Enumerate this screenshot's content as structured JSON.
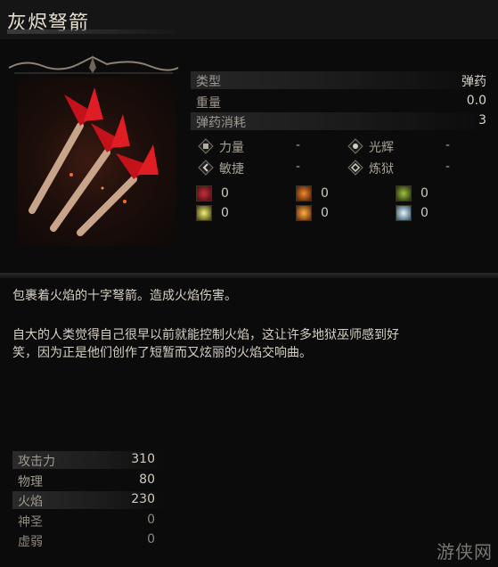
{
  "item": {
    "name": "灰烬弩箭"
  },
  "stats": [
    {
      "label": "类型",
      "value": "弹药"
    },
    {
      "label": "重量",
      "value": "0.0"
    },
    {
      "label": "弹药消耗",
      "value": "3"
    }
  ],
  "requirements": [
    {
      "label": "力量",
      "value": "-",
      "icon": "strength-icon"
    },
    {
      "label": "光辉",
      "value": "-",
      "icon": "radiance-icon"
    },
    {
      "label": "敏捷",
      "value": "-",
      "icon": "dexterity-icon"
    },
    {
      "label": "炼狱",
      "value": "-",
      "icon": "inferno-icon"
    }
  ],
  "elements": [
    {
      "value": "0",
      "icon": "bleed-icon",
      "color": "#7a1a1a"
    },
    {
      "value": "0",
      "icon": "fire-icon",
      "color": "#b44a12"
    },
    {
      "value": "0",
      "icon": "poison-icon",
      "color": "#4f6a1c"
    },
    {
      "value": "0",
      "icon": "lightning-icon",
      "color": "#c9c23a"
    },
    {
      "value": "0",
      "icon": "burn-icon",
      "color": "#d0631a"
    },
    {
      "value": "0",
      "icon": "frost-icon",
      "color": "#7fb4c2"
    }
  ],
  "description": {
    "line1": "包裹着火焰的十字弩箭。造成火焰伤害。",
    "line2a": "自大的人类觉得自己很早以前就能控制火焰，这让许多地狱巫师感到好",
    "line2b": "笑，因为正是他们创作了短暂而又炫丽的火焰交响曲。"
  },
  "attack": [
    {
      "label": "攻击力",
      "value": "310"
    },
    {
      "label": "物理",
      "value": "80"
    },
    {
      "label": "火焰",
      "value": "230"
    },
    {
      "label": "神圣",
      "value": "0"
    },
    {
      "label": "虚弱",
      "value": "0"
    }
  ],
  "watermark": "游侠网"
}
